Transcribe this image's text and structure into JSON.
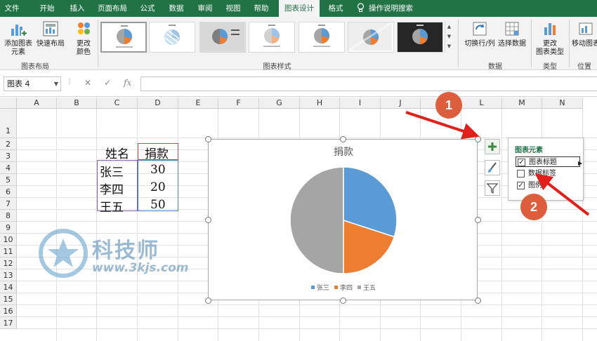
{
  "ribbon": {
    "tabs": [
      "文件",
      "开始",
      "插入",
      "页面布局",
      "公式",
      "数据",
      "审阅",
      "视图",
      "帮助",
      "图表设计",
      "格式"
    ],
    "active_tab": "图表设计",
    "tell_me": "操作说明搜索",
    "buttons": {
      "add_element": "添加图表\n元素",
      "quick_layout": "快速布局",
      "change_colors": "更改\n颜色",
      "switch_row_col": "切换行/列",
      "select_data": "选择数据",
      "change_type": "更改\n图表类型",
      "move_chart": "移动图表"
    },
    "groups": {
      "layout": "图表布局",
      "styles": "图表样式",
      "data": "数据",
      "type": "类型",
      "location": "位置"
    }
  },
  "formula_bar": {
    "name_box": "图表 4",
    "cancel": "✕",
    "enter": "✓",
    "fx": "fx",
    "value": ""
  },
  "sheet": {
    "columns": [
      "A",
      "B",
      "C",
      "D",
      "E",
      "F",
      "G",
      "H",
      "I",
      "J",
      "K",
      "L",
      "M",
      "N"
    ],
    "rows": [
      "1",
      "2",
      "3",
      "4",
      "5",
      "6",
      "7",
      "8",
      "9",
      "10",
      "11",
      "12",
      "13",
      "14",
      "15",
      "16",
      "17"
    ],
    "table": {
      "header_name": "姓名",
      "header_amount": "捐款",
      "rows": [
        {
          "name": "张三",
          "amount": "30"
        },
        {
          "name": "李四",
          "amount": "20"
        },
        {
          "name": "王五",
          "amount": "50"
        }
      ]
    }
  },
  "chart_data": {
    "type": "pie",
    "title": "捐款",
    "categories": [
      "张三",
      "李四",
      "王五"
    ],
    "values": [
      30,
      20,
      50
    ],
    "colors": [
      "#5b9bd5",
      "#ed7d31",
      "#a5a5a5"
    ],
    "legend": "bottom"
  },
  "flyout": {
    "title": "图表元素",
    "items": [
      {
        "label": "图表标题",
        "checked": "✓"
      },
      {
        "label": "数据标签",
        "checked": ""
      },
      {
        "label": "图例",
        "checked": "✓"
      }
    ]
  },
  "annotations": {
    "badge1": "1",
    "badge2": "2"
  },
  "watermark": {
    "name": "科技师",
    "url": "www.3kjs.com"
  }
}
